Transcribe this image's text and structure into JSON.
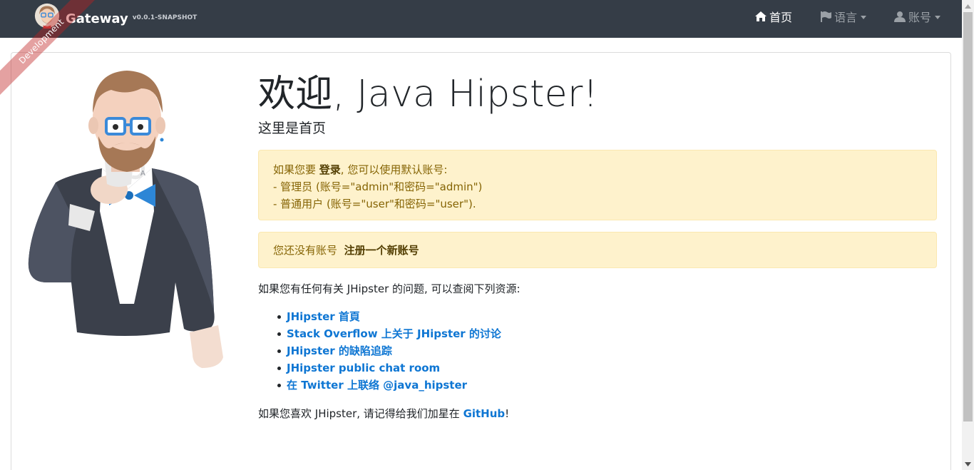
{
  "brand": {
    "name": "Gateway",
    "version": "v0.0.1-SNAPSHOT",
    "ribbon": "Development"
  },
  "nav": {
    "home": "首页",
    "language": "语言",
    "account": "账号"
  },
  "home": {
    "title_cn": "欢迎",
    "title_en": ", Java Hipster!",
    "subtitle": "这里是首页",
    "login_alert": {
      "prefix": "如果您要 ",
      "login_link": "登录",
      "suffix": ", 您可以使用默认账号:",
      "line_admin": "- 管理员 (账号=\"admin\"和密码=\"admin\")",
      "line_user": "- 普通用户 (账号=\"user\"和密码=\"user\")."
    },
    "register_alert": {
      "prefix": "您还没有账号",
      "register_link": "注册一个新账号"
    },
    "resources_intro": "如果您有任何有关 JHipster 的问题, 可以查阅下列资源:",
    "resources": [
      "JHipster 首頁",
      "Stack Overflow 上关于 JHipster 的讨论",
      "JHipster 的缺陷追踪",
      "JHipster public chat room",
      "在 Twitter 上联络 @java_hipster"
    ],
    "star_prefix": "如果您喜欢 JHipster, 请记得给我们加星在 ",
    "star_link": "GitHub",
    "star_suffix": "!"
  },
  "icons": {
    "home": "home-icon",
    "language": "flag-icon",
    "account": "user-icon"
  }
}
